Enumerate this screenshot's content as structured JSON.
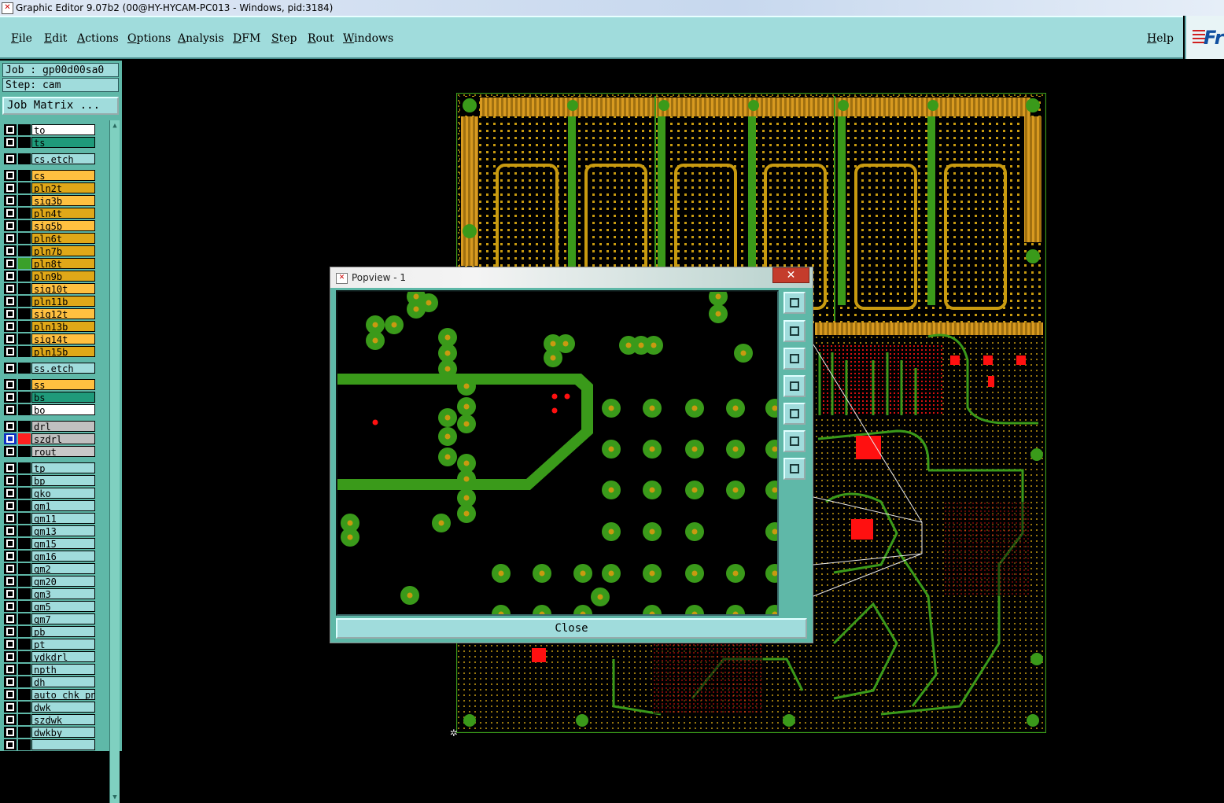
{
  "window": {
    "title": "Graphic Editor 9.07b2 (00@HY-HYCAM-PC013 - Windows, pid:3184)"
  },
  "menu": {
    "items": [
      "File",
      "Edit",
      "Actions",
      "Options",
      "Analysis",
      "DFM",
      "Step",
      "Rout",
      "Windows"
    ],
    "help": "Help",
    "logo_text": "Fr"
  },
  "job": {
    "job_label": "Job : gp00d00sa0",
    "step_label": "Step: cam",
    "matrix_button": "Job Matrix ..."
  },
  "layers": [
    {
      "name": "to",
      "color": "#ffffff",
      "gap": false
    },
    {
      "name": "ts",
      "color": "#1f9a7a",
      "gap": false
    },
    {
      "name": "cs.etch",
      "color": "#a0dcdc",
      "gap": true
    },
    {
      "name": "cs",
      "color": "#ffc040",
      "gap": true
    },
    {
      "name": "pln2t",
      "color": "#e0a818",
      "gap": false
    },
    {
      "name": "sig3b",
      "color": "#ffc040",
      "gap": false
    },
    {
      "name": "pln4t",
      "color": "#e0a818",
      "gap": false
    },
    {
      "name": "sig5b",
      "color": "#ffc040",
      "gap": false
    },
    {
      "name": "pln6t",
      "color": "#e0a818",
      "gap": false
    },
    {
      "name": "pln7b",
      "color": "#e0a818",
      "gap": false
    },
    {
      "name": "pln8t",
      "color": "#e0a818",
      "gap": false,
      "swatch": "#3aa02a"
    },
    {
      "name": "pln9b",
      "color": "#e0a818",
      "gap": false
    },
    {
      "name": "sig10t",
      "color": "#ffc040",
      "gap": false
    },
    {
      "name": "pln11b",
      "color": "#e0a818",
      "gap": false
    },
    {
      "name": "sig12t",
      "color": "#ffc040",
      "gap": false
    },
    {
      "name": "pln13b",
      "color": "#e0a818",
      "gap": false
    },
    {
      "name": "sig14t",
      "color": "#ffc040",
      "gap": false
    },
    {
      "name": "pln15b",
      "color": "#e0a818",
      "gap": false
    },
    {
      "name": "ss.etch",
      "color": "#a0dcdc",
      "gap": true
    },
    {
      "name": "ss",
      "color": "#ffc040",
      "gap": true
    },
    {
      "name": "bs",
      "color": "#1f9a7a",
      "gap": false
    },
    {
      "name": "bo",
      "color": "#ffffff",
      "gap": false
    },
    {
      "name": "drl",
      "color": "#c0c0c0",
      "gap": true
    },
    {
      "name": "szdrl",
      "color": "#c0c0c0",
      "gap": false,
      "swatch": "#ff2020",
      "selected": true
    },
    {
      "name": "rout",
      "color": "#c8c8c8",
      "gap": false
    },
    {
      "name": "tp",
      "color": "#a0dcdc",
      "gap": true
    },
    {
      "name": "bp",
      "color": "#a0dcdc",
      "gap": false
    },
    {
      "name": "gko",
      "color": "#a0dcdc",
      "gap": false
    },
    {
      "name": "gm1",
      "color": "#a0dcdc",
      "gap": false
    },
    {
      "name": "gm11",
      "color": "#a0dcdc",
      "gap": false
    },
    {
      "name": "gm13",
      "color": "#a0dcdc",
      "gap": false
    },
    {
      "name": "gm15",
      "color": "#a0dcdc",
      "gap": false
    },
    {
      "name": "gm16",
      "color": "#a0dcdc",
      "gap": false
    },
    {
      "name": "gm2",
      "color": "#a0dcdc",
      "gap": false
    },
    {
      "name": "gm20",
      "color": "#a0dcdc",
      "gap": false
    },
    {
      "name": "gm3",
      "color": "#a0dcdc",
      "gap": false
    },
    {
      "name": "gm5",
      "color": "#a0dcdc",
      "gap": false
    },
    {
      "name": "gm7",
      "color": "#a0dcdc",
      "gap": false
    },
    {
      "name": "pb",
      "color": "#a0dcdc",
      "gap": false
    },
    {
      "name": "pt",
      "color": "#a0dcdc",
      "gap": false
    },
    {
      "name": "ydkdrl",
      "color": "#a0dcdc",
      "gap": false
    },
    {
      "name": "npth",
      "color": "#a0dcdc",
      "gap": false
    },
    {
      "name": "dh",
      "color": "#a0dcdc",
      "gap": false
    },
    {
      "name": "auto_chk_pnl",
      "color": "#a0dcdc",
      "gap": false
    },
    {
      "name": "dwk",
      "color": "#a0dcdc",
      "gap": false
    },
    {
      "name": "szdwk",
      "color": "#a0dcdc",
      "gap": false
    },
    {
      "name": "dwkby",
      "color": "#a0dcdc",
      "gap": false
    },
    {
      "name": "",
      "color": "#a0dcdc",
      "gap": false
    }
  ],
  "popview": {
    "title": "Popview - 1",
    "close_x": "✕",
    "close_button": "Close"
  },
  "colors": {
    "panel": "#a0dcdc",
    "board_green": "#3a9a1a",
    "pad_orange": "#c89a10",
    "marker_red": "#ff1010"
  },
  "icons": {
    "cursor": "crosshair-cursor-icon"
  }
}
